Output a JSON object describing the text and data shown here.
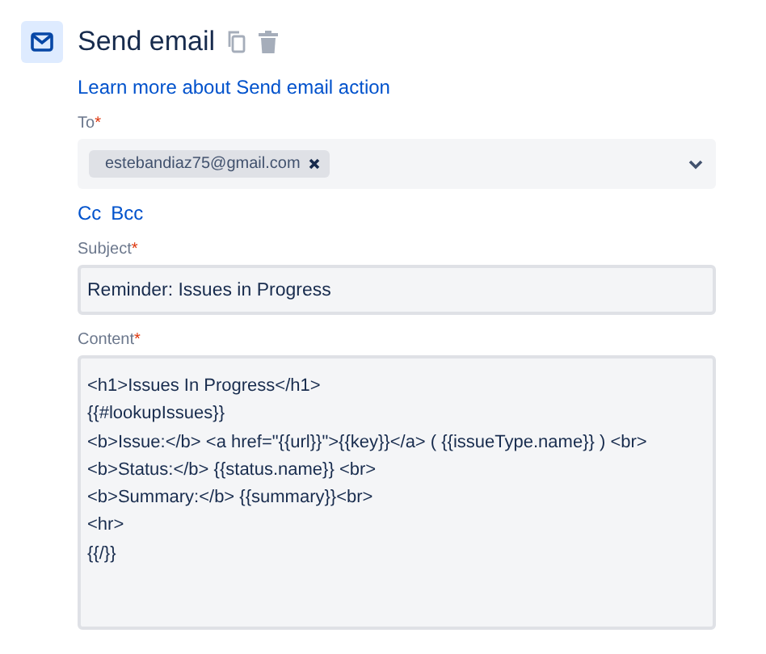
{
  "header": {
    "title": "Send email"
  },
  "learn_more_link": "Learn more about Send email action",
  "to": {
    "label": "To",
    "required_mark": "*",
    "recipients": [
      {
        "address": "estebandiaz75@gmail.com"
      }
    ]
  },
  "copy_links": [
    "Cc",
    "Bcc"
  ],
  "subject": {
    "label": "Subject",
    "required_mark": "*",
    "value": "Reminder: Issues in Progress"
  },
  "content": {
    "label": "Content",
    "required_mark": "*",
    "value": "<h1>Issues In Progress</h1>\n{{#lookupIssues}}\n<b>Issue:</b> <a href=\"{{url}}\">{{key}}</a> ( {{issueType.name}} ) <br>\n<b>Status:</b> {{status.name}} <br>\n<b>Summary:</b> {{summary}}<br>\n<hr>\n{{/}}"
  }
}
